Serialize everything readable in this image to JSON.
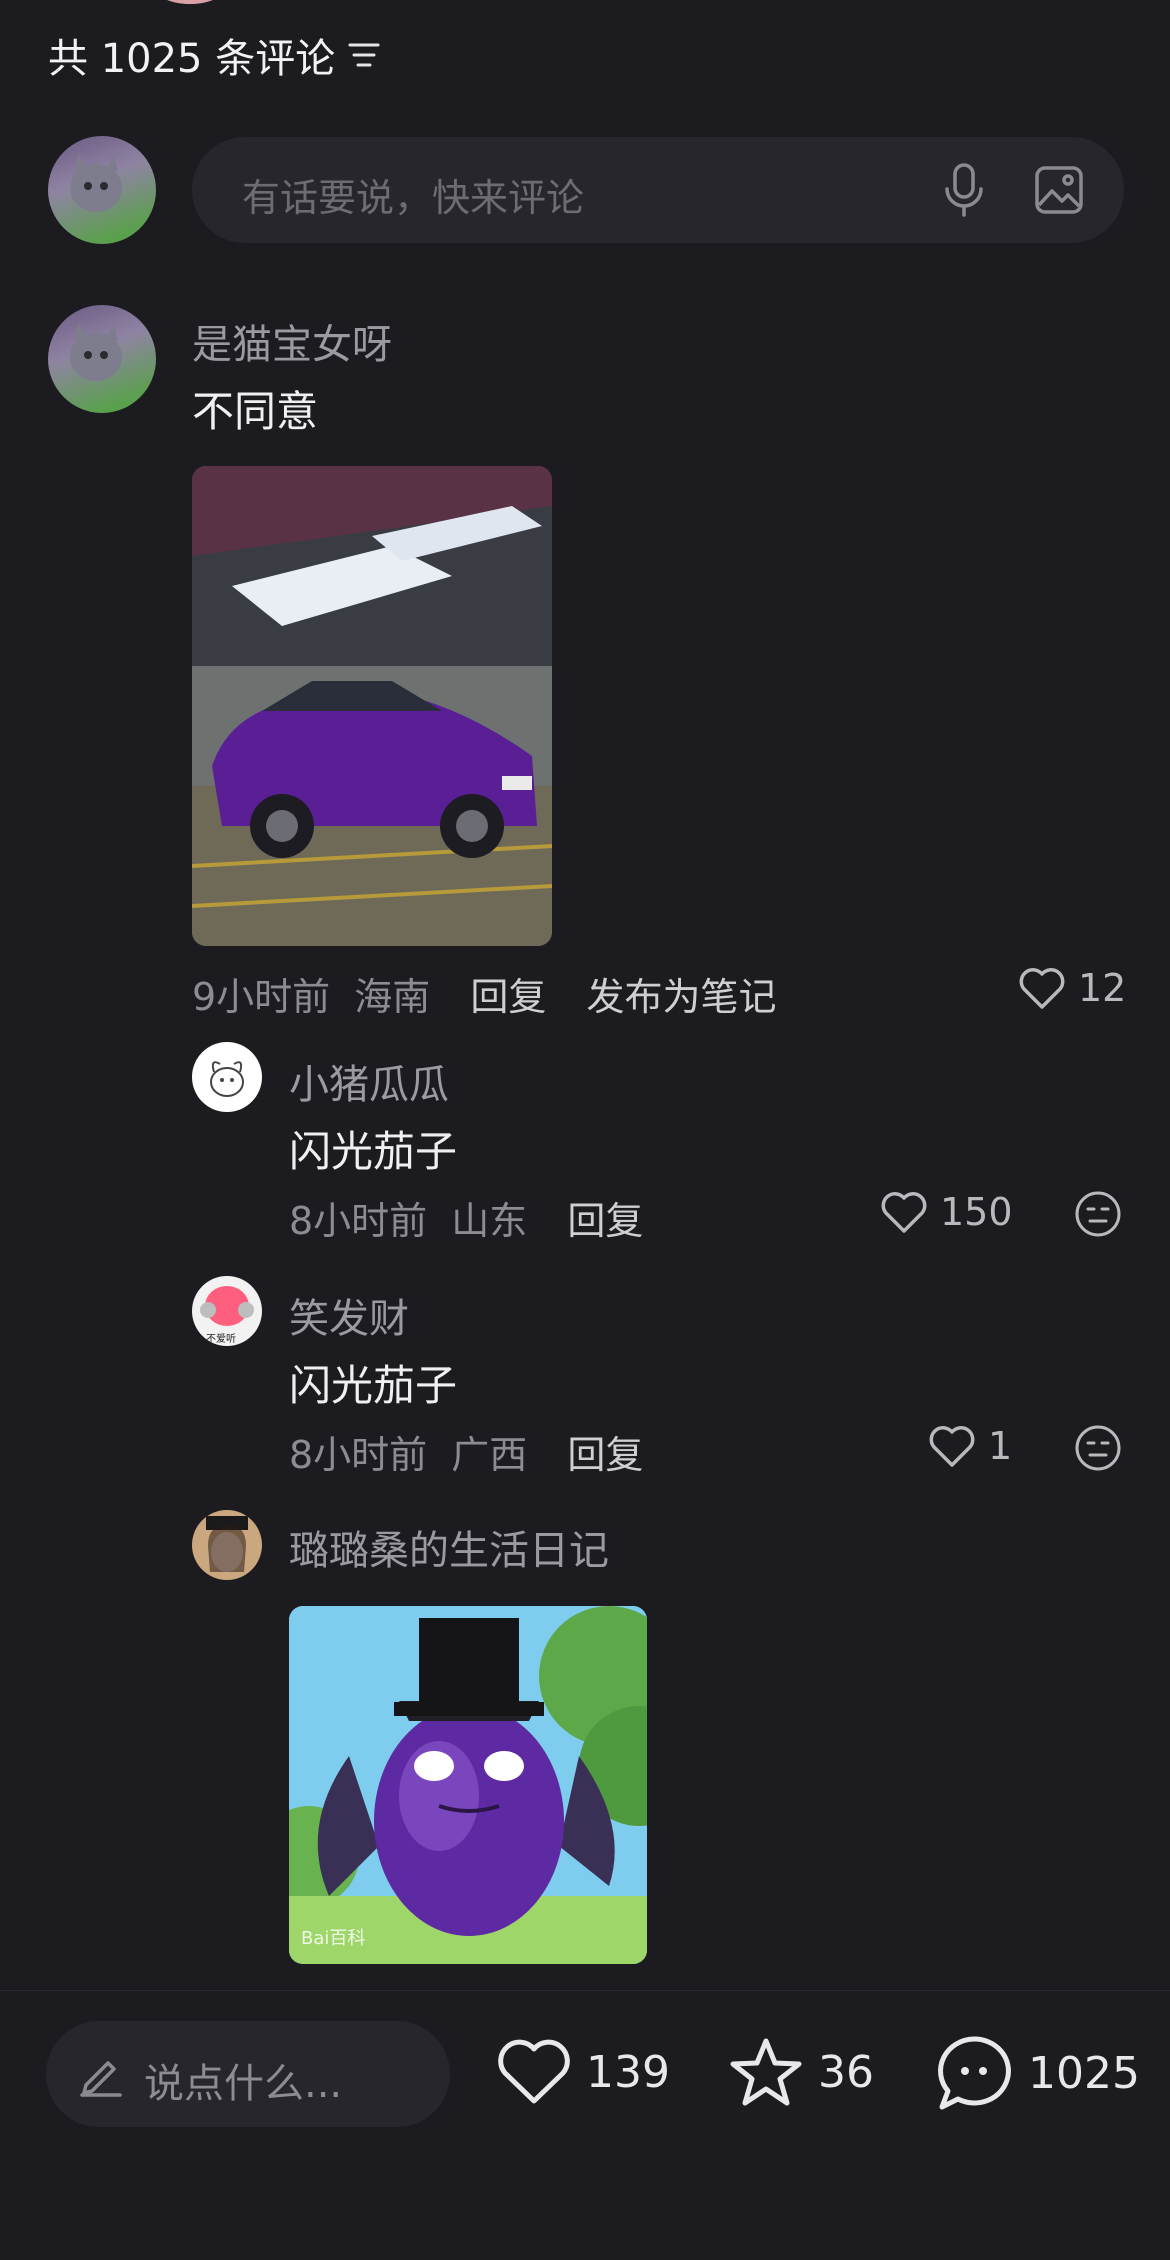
{
  "header": {
    "count_label": "共 1025 条评论"
  },
  "composer": {
    "placeholder": "有话要说，快来评论"
  },
  "comments": [
    {
      "user": "是猫宝女呀",
      "text": "不同意",
      "time": "9小时前",
      "location": "海南",
      "reply_label": "回复",
      "publish_label": "发布为笔记",
      "likes": "12"
    }
  ],
  "replies": [
    {
      "user": "小猪瓜瓜",
      "text": "闪光茄子",
      "time": "8小时前",
      "location": "山东",
      "reply_label": "回复",
      "likes": "150"
    },
    {
      "user": "笑发财",
      "avatar_text": "不爱听",
      "text": "闪光茄子",
      "time": "8小时前",
      "location": "广西",
      "reply_label": "回复",
      "likes": "1"
    },
    {
      "user": "璐璐桑的生活日记",
      "image_watermark": "Bai百科"
    }
  ],
  "bottom_bar": {
    "input_placeholder": "说点什么...",
    "likes": "139",
    "favorites": "36",
    "comments": "1025"
  },
  "colors": {
    "background": "#1b1b20",
    "input_bg": "#26262c",
    "accent_purple": "#6a2bbd"
  },
  "icons": [
    "filter-icon",
    "microphone-icon",
    "image-icon",
    "heart-icon",
    "neutral-face-icon",
    "pencil-icon",
    "star-icon",
    "comment-bubble-icon"
  ]
}
